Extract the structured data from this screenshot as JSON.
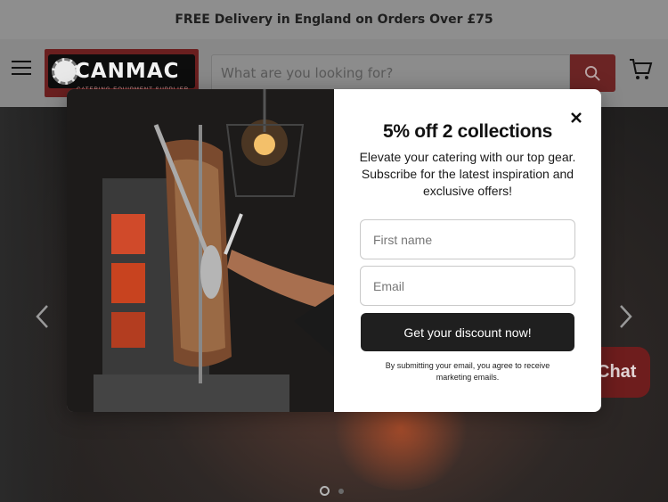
{
  "announcement": {
    "text": "FREE Delivery in England on Orders Over £75"
  },
  "header": {
    "logo": {
      "name": "CANMAC",
      "tagline": "CATERING EQUIPMENT SUPPLIER"
    },
    "search": {
      "placeholder": "What are you looking for?"
    },
    "icons": {
      "menu": "hamburger-icon",
      "search": "search-icon",
      "cart": "cart-icon"
    }
  },
  "hero": {
    "slides_total": 2,
    "active_slide": 1
  },
  "chat": {
    "label": "Chat"
  },
  "popup": {
    "title": "5% off 2 collections",
    "description": "Elevate your catering with our top gear. Subscribe for the latest inspiration and exclusive offers!",
    "first_name_placeholder": "First name",
    "email_placeholder": "Email",
    "submit_label": "Get your discount now!",
    "disclaimer": "By submitting your email, you agree to receive marketing emails."
  },
  "colors": {
    "brand": "#b82b2b",
    "button": "#1f1f1f",
    "overlay_tint": "#888888"
  }
}
